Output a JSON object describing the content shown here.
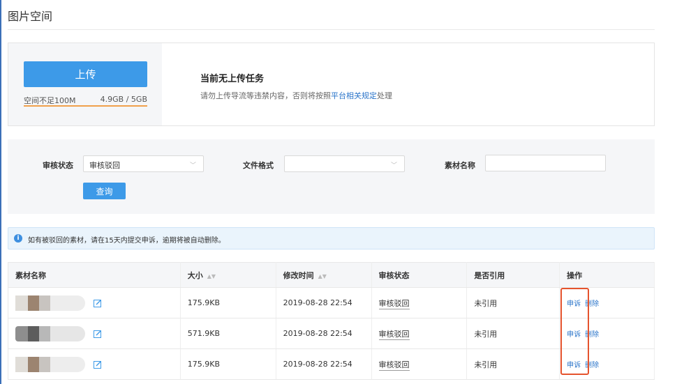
{
  "page": {
    "title": "图片空间"
  },
  "upload": {
    "button_label": "上传",
    "space_warning": "空间不足100M",
    "space_usage": "4.9GB / 5GB",
    "task_title": "当前无上传任务",
    "task_desc_prefix": "请勿上传导流等违禁内容，否则将按照",
    "task_desc_link": "平台相关规定",
    "task_desc_suffix": "处理"
  },
  "filter": {
    "audit_status_label": "审核状态",
    "audit_status_value": "审核驳回",
    "file_format_label": "文件格式",
    "file_format_value": "",
    "material_name_label": "素材名称",
    "material_name_value": "",
    "query_label": "查询"
  },
  "notice": {
    "icon": "info-icon",
    "text": "如有被驳回的素材，请在15天内提交申诉，逾期将被自动删除。"
  },
  "table": {
    "headers": [
      "素材名称",
      "大小",
      "修改时间",
      "审核状态",
      "是否引用",
      "操作"
    ],
    "rows": [
      {
        "size": "175.9KB",
        "modified": "2019-08-28 22:54",
        "audit": "审核驳回",
        "referenced": "未引用",
        "appeal": "申诉",
        "delete": "删除"
      },
      {
        "size": "571.9KB",
        "modified": "2019-08-28 22:54",
        "audit": "审核驳回",
        "referenced": "未引用",
        "appeal": "申诉",
        "delete": "删除"
      },
      {
        "size": "175.9KB",
        "modified": "2019-08-28 22:54",
        "audit": "审核驳回",
        "referenced": "未引用",
        "appeal": "申诉",
        "delete": "删除"
      }
    ]
  },
  "colors": {
    "primary": "#3d9ae8",
    "link": "#2a74c9",
    "warning_bar": "#f0a04b",
    "highlight": "#e5532d"
  }
}
